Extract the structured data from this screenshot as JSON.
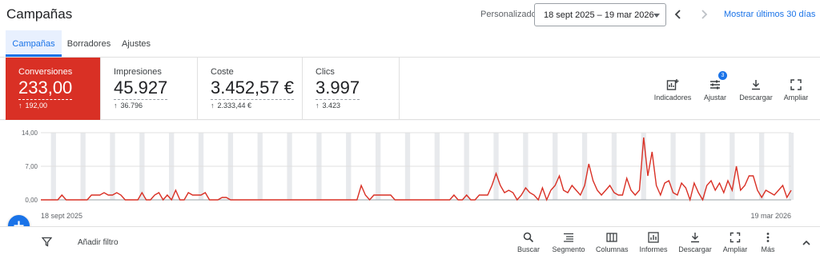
{
  "header": {
    "title": "Campañas",
    "date_label": "Personalizado",
    "date_range": "18 sept 2025 – 19 mar 2026",
    "show_last": "Mostrar últimos 30 días"
  },
  "tabs": [
    {
      "label": "Campañas",
      "active": true
    },
    {
      "label": "Borradores",
      "active": false
    },
    {
      "label": "Ajustes",
      "active": false
    }
  ],
  "metrics": [
    {
      "name": "Conversiones",
      "value": "233,00",
      "delta": "192,00",
      "selected": true
    },
    {
      "name": "Impresiones",
      "value": "45.927",
      "delta": "36.796",
      "selected": false
    },
    {
      "name": "Coste",
      "value": "3.452,57 €",
      "delta": "2.333,44 €",
      "selected": false
    },
    {
      "name": "Clics",
      "value": "3.997",
      "delta": "3.423",
      "selected": false
    }
  ],
  "tools": {
    "indicators": "Indicadores",
    "adjust": "Ajustar",
    "adjust_badge": "3",
    "download": "Descargar",
    "expand": "Ampliar"
  },
  "chart_data": {
    "type": "line",
    "series": [
      {
        "name": "Conversiones",
        "color": "#d93025",
        "values": [
          0,
          0,
          0,
          0,
          0,
          1,
          0,
          0,
          0,
          0,
          0,
          0,
          1,
          1,
          1,
          1.5,
          1,
          1,
          1.5,
          1,
          0,
          0,
          0,
          0,
          1.5,
          0,
          0,
          1,
          1.5,
          0,
          1,
          0,
          2,
          0,
          0,
          1.5,
          1,
          1,
          1,
          1.5,
          0,
          0,
          0,
          0.5,
          0.5,
          0,
          0,
          0,
          0,
          0,
          0,
          0,
          0,
          0,
          0,
          0,
          0,
          0,
          0,
          0,
          0,
          0,
          0,
          0,
          0,
          0,
          0,
          0,
          0,
          0,
          0,
          0,
          0,
          0,
          0,
          0,
          3,
          1,
          0,
          1,
          1,
          1,
          1,
          1,
          0,
          0,
          0,
          0,
          0,
          0,
          0,
          0,
          0,
          0,
          0,
          0,
          0,
          0,
          1,
          0,
          0,
          1,
          0,
          0,
          1,
          1,
          1,
          3,
          5.5,
          3,
          1.5,
          2,
          1.5,
          0,
          1,
          2.5,
          1.5,
          1,
          0,
          2.5,
          0,
          2,
          3,
          5,
          2,
          1.5,
          3,
          2,
          1,
          3,
          7.5,
          4,
          2,
          1,
          2,
          3,
          1.5,
          1,
          1,
          4.5,
          2,
          1,
          2,
          13,
          5,
          10,
          3,
          1,
          3.5,
          4,
          1.5,
          1,
          3.5,
          2.5,
          0,
          3.5,
          1.5,
          0,
          3,
          4,
          2,
          3.5,
          1.5,
          4,
          2,
          7,
          2,
          3,
          5,
          5,
          2,
          0.5,
          2,
          1.5,
          1,
          2,
          3,
          0.5,
          2
        ]
      }
    ],
    "x_labels": [
      "18 sept 2025",
      "19 mar 2026"
    ],
    "y_ticks": [
      "14,00",
      "7,00",
      "0,00"
    ],
    "ylim": [
      0,
      14
    ],
    "grid": true
  },
  "filterbar": {
    "add_filter": "Añadir filtro",
    "tools": [
      "Buscar",
      "Segmento",
      "Columnas",
      "Informes",
      "Descargar",
      "Ampliar",
      "Más"
    ]
  }
}
